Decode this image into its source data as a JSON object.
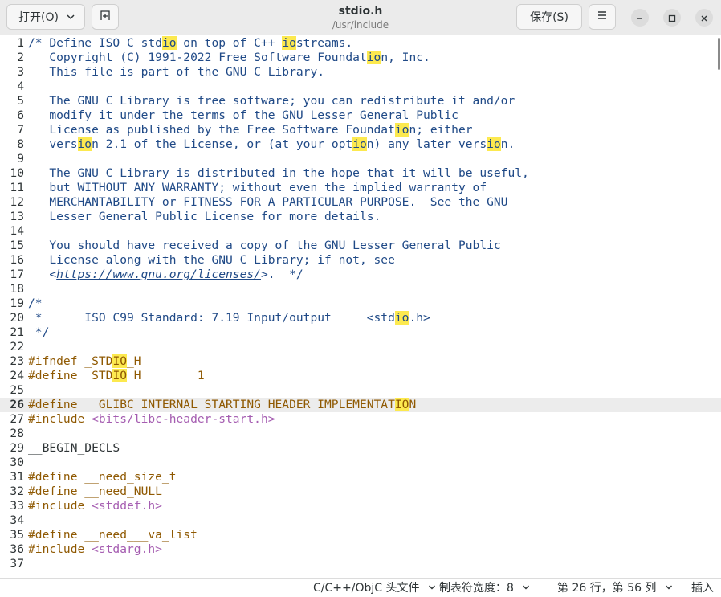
{
  "header": {
    "open_label": "打开(O)",
    "save_label": "保存(S)",
    "title": "stdio.h",
    "subtitle": "/usr/include"
  },
  "editor": {
    "current_line": 26,
    "lines": [
      {
        "n": "1",
        "segs": [
          {
            "t": "/* Define ISO C std",
            "c": "comment"
          },
          {
            "t": "io",
            "c": "comment",
            "hl": true
          },
          {
            "t": " on top of C++ ",
            "c": "comment"
          },
          {
            "t": "io",
            "c": "comment",
            "hl": true
          },
          {
            "t": "streams.",
            "c": "comment"
          }
        ]
      },
      {
        "n": "2",
        "segs": [
          {
            "t": "   Copyright (C) 1991-2022 Free Software Foundat",
            "c": "comment"
          },
          {
            "t": "io",
            "c": "comment",
            "hl": true
          },
          {
            "t": "n, Inc.",
            "c": "comment"
          }
        ]
      },
      {
        "n": "3",
        "segs": [
          {
            "t": "   This file is part of the GNU C Library.",
            "c": "comment"
          }
        ]
      },
      {
        "n": "4",
        "segs": []
      },
      {
        "n": "5",
        "segs": [
          {
            "t": "   The GNU C Library is free software; you can redistribute it and/or",
            "c": "comment"
          }
        ]
      },
      {
        "n": "6",
        "segs": [
          {
            "t": "   modify it under the terms of the GNU Lesser General Public",
            "c": "comment"
          }
        ]
      },
      {
        "n": "7",
        "segs": [
          {
            "t": "   License as published by the Free Software Foundat",
            "c": "comment"
          },
          {
            "t": "io",
            "c": "comment",
            "hl": true
          },
          {
            "t": "n; either",
            "c": "comment"
          }
        ]
      },
      {
        "n": "8",
        "segs": [
          {
            "t": "   vers",
            "c": "comment"
          },
          {
            "t": "io",
            "c": "comment",
            "hl": true
          },
          {
            "t": "n 2.1 of the License, or (at your opt",
            "c": "comment"
          },
          {
            "t": "io",
            "c": "comment",
            "hl": true
          },
          {
            "t": "n) any later vers",
            "c": "comment"
          },
          {
            "t": "io",
            "c": "comment",
            "hl": true
          },
          {
            "t": "n.",
            "c": "comment"
          }
        ]
      },
      {
        "n": "9",
        "segs": []
      },
      {
        "n": "10",
        "segs": [
          {
            "t": "   The GNU C Library is distributed in the hope that it will be useful,",
            "c": "comment"
          }
        ]
      },
      {
        "n": "11",
        "segs": [
          {
            "t": "   but WITHOUT ANY WARRANTY; without even the implied warranty of",
            "c": "comment"
          }
        ]
      },
      {
        "n": "12",
        "segs": [
          {
            "t": "   MERCHANTABILITY or FITNESS FOR A PARTICULAR PURPOSE.  See the GNU",
            "c": "comment"
          }
        ]
      },
      {
        "n": "13",
        "segs": [
          {
            "t": "   Lesser General Public License for more details.",
            "c": "comment"
          }
        ]
      },
      {
        "n": "14",
        "segs": []
      },
      {
        "n": "15",
        "segs": [
          {
            "t": "   You should have received a copy of the GNU Lesser General Public",
            "c": "comment"
          }
        ]
      },
      {
        "n": "16",
        "segs": [
          {
            "t": "   License along with the GNU C Library; if not, see",
            "c": "comment"
          }
        ]
      },
      {
        "n": "17",
        "segs": [
          {
            "t": "   <",
            "c": "comment"
          },
          {
            "t": "https://www.gnu.org/licenses/",
            "c": "link"
          },
          {
            "t": ">.  */",
            "c": "comment"
          }
        ]
      },
      {
        "n": "18",
        "segs": []
      },
      {
        "n": "19",
        "segs": [
          {
            "t": "/*",
            "c": "comment"
          }
        ]
      },
      {
        "n": "20",
        "segs": [
          {
            "t": " *      ISO C99 Standard: 7.19 Input/output     <std",
            "c": "comment"
          },
          {
            "t": "io",
            "c": "comment",
            "hl": true
          },
          {
            "t": ".h>",
            "c": "comment"
          }
        ]
      },
      {
        "n": "21",
        "segs": [
          {
            "t": " */",
            "c": "comment"
          }
        ]
      },
      {
        "n": "22",
        "segs": []
      },
      {
        "n": "23",
        "segs": [
          {
            "t": "#ifndef _STD",
            "c": "pre"
          },
          {
            "t": "IO",
            "c": "pre",
            "hl": true
          },
          {
            "t": "_H",
            "c": "pre"
          }
        ]
      },
      {
        "n": "24",
        "segs": [
          {
            "t": "#define _STD",
            "c": "pre"
          },
          {
            "t": "IO",
            "c": "pre",
            "hl": true
          },
          {
            "t": "_H        1",
            "c": "pre"
          }
        ]
      },
      {
        "n": "25",
        "segs": []
      },
      {
        "n": "26",
        "segs": [
          {
            "t": "#define __GLIBC_INTERNAL_STARTING_HEADER_IMPLEMENTAT",
            "c": "pre"
          },
          {
            "t": "IO",
            "c": "pre",
            "hl": true
          },
          {
            "t": "N",
            "c": "pre"
          }
        ]
      },
      {
        "n": "27",
        "segs": [
          {
            "t": "#include ",
            "c": "pre"
          },
          {
            "t": "<bits/libc-header-start.h>",
            "c": "inc"
          }
        ]
      },
      {
        "n": "28",
        "segs": []
      },
      {
        "n": "29",
        "segs": [
          {
            "t": "__BEGIN_DECLS",
            "c": "plain"
          }
        ]
      },
      {
        "n": "30",
        "segs": []
      },
      {
        "n": "31",
        "segs": [
          {
            "t": "#define __need_size_t",
            "c": "pre"
          }
        ]
      },
      {
        "n": "32",
        "segs": [
          {
            "t": "#define __need_NULL",
            "c": "pre"
          }
        ]
      },
      {
        "n": "33",
        "segs": [
          {
            "t": "#include ",
            "c": "pre"
          },
          {
            "t": "<stddef.h>",
            "c": "inc"
          }
        ]
      },
      {
        "n": "34",
        "segs": []
      },
      {
        "n": "35",
        "segs": [
          {
            "t": "#define __need___va_list",
            "c": "pre"
          }
        ]
      },
      {
        "n": "36",
        "segs": [
          {
            "t": "#include ",
            "c": "pre"
          },
          {
            "t": "<stdarg.h>",
            "c": "inc"
          }
        ]
      },
      {
        "n": "37",
        "segs": []
      }
    ]
  },
  "statusbar": {
    "language": "C/C++/ObjC 头文件",
    "tab_width": "制表符宽度：8",
    "position": "第 26 行，第 56 列",
    "mode": "插入"
  },
  "colors": {
    "comment": "#204a87",
    "preprocessor": "#8f5902",
    "include_path": "#a55db1",
    "highlight": "#fce94f"
  },
  "icons": [
    "chevron-down-icon",
    "new-tab-icon",
    "hamburger-menu-icon",
    "minimize-icon",
    "maximize-icon",
    "close-icon"
  ]
}
